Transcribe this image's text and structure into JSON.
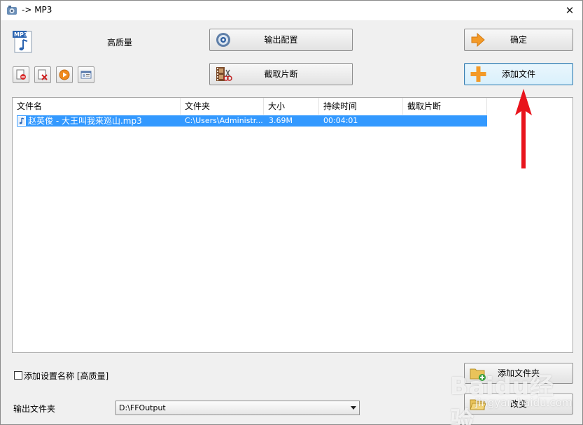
{
  "window": {
    "title": "-> MP3",
    "close_label": "✕"
  },
  "profile": {
    "format_icon_text": "MP3",
    "quality": "高质量"
  },
  "buttons": {
    "output_config": "输出配置",
    "confirm": "确定",
    "cut_clip": "截取片断",
    "add_file": "添加文件",
    "add_folder": "添加文件夹",
    "change": "改变"
  },
  "file_list": {
    "columns": [
      "文件名",
      "文件夹",
      "大小",
      "持续时间",
      "截取片断"
    ],
    "rows": [
      {
        "name": "赵英俊 - 大王叫我来巡山.mp3",
        "folder": "C:\\Users\\Administr...",
        "size": "3.69M",
        "duration": "00:04:01",
        "clip": ""
      }
    ]
  },
  "options": {
    "add_setting_name_label": "添加设置名称 [高质量]",
    "add_setting_name_checked": false,
    "output_folder_label": "输出文件夹",
    "output_folder_value": "D:\\FFOutput"
  },
  "watermark": {
    "main": "Baidu经验",
    "sub": "jingyan.baidu.com"
  },
  "colors": {
    "selection": "#3399ff",
    "annotation_arrow": "#e8141c",
    "window_bg": "#f0f0f0"
  }
}
